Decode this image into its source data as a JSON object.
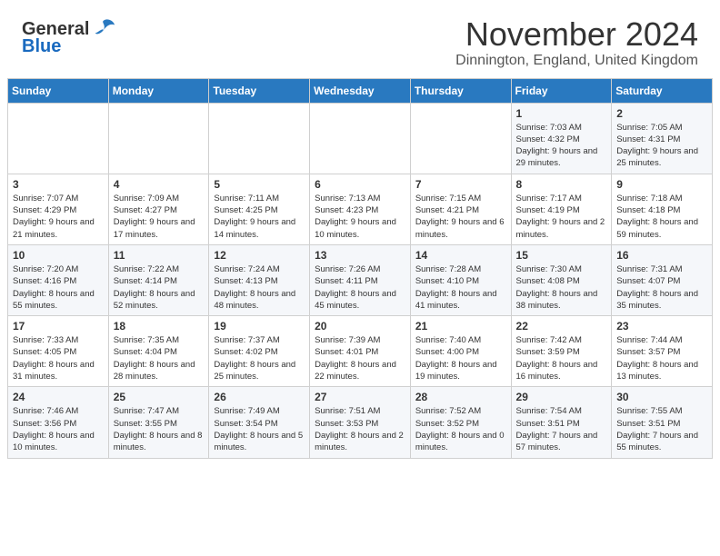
{
  "header": {
    "logo": {
      "general": "General",
      "blue": "Blue"
    },
    "title": "November 2024",
    "location": "Dinnington, England, United Kingdom"
  },
  "calendar": {
    "days_of_week": [
      "Sunday",
      "Monday",
      "Tuesday",
      "Wednesday",
      "Thursday",
      "Friday",
      "Saturday"
    ],
    "weeks": [
      [
        {
          "day": "",
          "info": ""
        },
        {
          "day": "",
          "info": ""
        },
        {
          "day": "",
          "info": ""
        },
        {
          "day": "",
          "info": ""
        },
        {
          "day": "",
          "info": ""
        },
        {
          "day": "1",
          "info": "Sunrise: 7:03 AM\nSunset: 4:32 PM\nDaylight: 9 hours and 29 minutes."
        },
        {
          "day": "2",
          "info": "Sunrise: 7:05 AM\nSunset: 4:31 PM\nDaylight: 9 hours and 25 minutes."
        }
      ],
      [
        {
          "day": "3",
          "info": "Sunrise: 7:07 AM\nSunset: 4:29 PM\nDaylight: 9 hours and 21 minutes."
        },
        {
          "day": "4",
          "info": "Sunrise: 7:09 AM\nSunset: 4:27 PM\nDaylight: 9 hours and 17 minutes."
        },
        {
          "day": "5",
          "info": "Sunrise: 7:11 AM\nSunset: 4:25 PM\nDaylight: 9 hours and 14 minutes."
        },
        {
          "day": "6",
          "info": "Sunrise: 7:13 AM\nSunset: 4:23 PM\nDaylight: 9 hours and 10 minutes."
        },
        {
          "day": "7",
          "info": "Sunrise: 7:15 AM\nSunset: 4:21 PM\nDaylight: 9 hours and 6 minutes."
        },
        {
          "day": "8",
          "info": "Sunrise: 7:17 AM\nSunset: 4:19 PM\nDaylight: 9 hours and 2 minutes."
        },
        {
          "day": "9",
          "info": "Sunrise: 7:18 AM\nSunset: 4:18 PM\nDaylight: 8 hours and 59 minutes."
        }
      ],
      [
        {
          "day": "10",
          "info": "Sunrise: 7:20 AM\nSunset: 4:16 PM\nDaylight: 8 hours and 55 minutes."
        },
        {
          "day": "11",
          "info": "Sunrise: 7:22 AM\nSunset: 4:14 PM\nDaylight: 8 hours and 52 minutes."
        },
        {
          "day": "12",
          "info": "Sunrise: 7:24 AM\nSunset: 4:13 PM\nDaylight: 8 hours and 48 minutes."
        },
        {
          "day": "13",
          "info": "Sunrise: 7:26 AM\nSunset: 4:11 PM\nDaylight: 8 hours and 45 minutes."
        },
        {
          "day": "14",
          "info": "Sunrise: 7:28 AM\nSunset: 4:10 PM\nDaylight: 8 hours and 41 minutes."
        },
        {
          "day": "15",
          "info": "Sunrise: 7:30 AM\nSunset: 4:08 PM\nDaylight: 8 hours and 38 minutes."
        },
        {
          "day": "16",
          "info": "Sunrise: 7:31 AM\nSunset: 4:07 PM\nDaylight: 8 hours and 35 minutes."
        }
      ],
      [
        {
          "day": "17",
          "info": "Sunrise: 7:33 AM\nSunset: 4:05 PM\nDaylight: 8 hours and 31 minutes."
        },
        {
          "day": "18",
          "info": "Sunrise: 7:35 AM\nSunset: 4:04 PM\nDaylight: 8 hours and 28 minutes."
        },
        {
          "day": "19",
          "info": "Sunrise: 7:37 AM\nSunset: 4:02 PM\nDaylight: 8 hours and 25 minutes."
        },
        {
          "day": "20",
          "info": "Sunrise: 7:39 AM\nSunset: 4:01 PM\nDaylight: 8 hours and 22 minutes."
        },
        {
          "day": "21",
          "info": "Sunrise: 7:40 AM\nSunset: 4:00 PM\nDaylight: 8 hours and 19 minutes."
        },
        {
          "day": "22",
          "info": "Sunrise: 7:42 AM\nSunset: 3:59 PM\nDaylight: 8 hours and 16 minutes."
        },
        {
          "day": "23",
          "info": "Sunrise: 7:44 AM\nSunset: 3:57 PM\nDaylight: 8 hours and 13 minutes."
        }
      ],
      [
        {
          "day": "24",
          "info": "Sunrise: 7:46 AM\nSunset: 3:56 PM\nDaylight: 8 hours and 10 minutes."
        },
        {
          "day": "25",
          "info": "Sunrise: 7:47 AM\nSunset: 3:55 PM\nDaylight: 8 hours and 8 minutes."
        },
        {
          "day": "26",
          "info": "Sunrise: 7:49 AM\nSunset: 3:54 PM\nDaylight: 8 hours and 5 minutes."
        },
        {
          "day": "27",
          "info": "Sunrise: 7:51 AM\nSunset: 3:53 PM\nDaylight: 8 hours and 2 minutes."
        },
        {
          "day": "28",
          "info": "Sunrise: 7:52 AM\nSunset: 3:52 PM\nDaylight: 8 hours and 0 minutes."
        },
        {
          "day": "29",
          "info": "Sunrise: 7:54 AM\nSunset: 3:51 PM\nDaylight: 7 hours and 57 minutes."
        },
        {
          "day": "30",
          "info": "Sunrise: 7:55 AM\nSunset: 3:51 PM\nDaylight: 7 hours and 55 minutes."
        }
      ]
    ]
  }
}
